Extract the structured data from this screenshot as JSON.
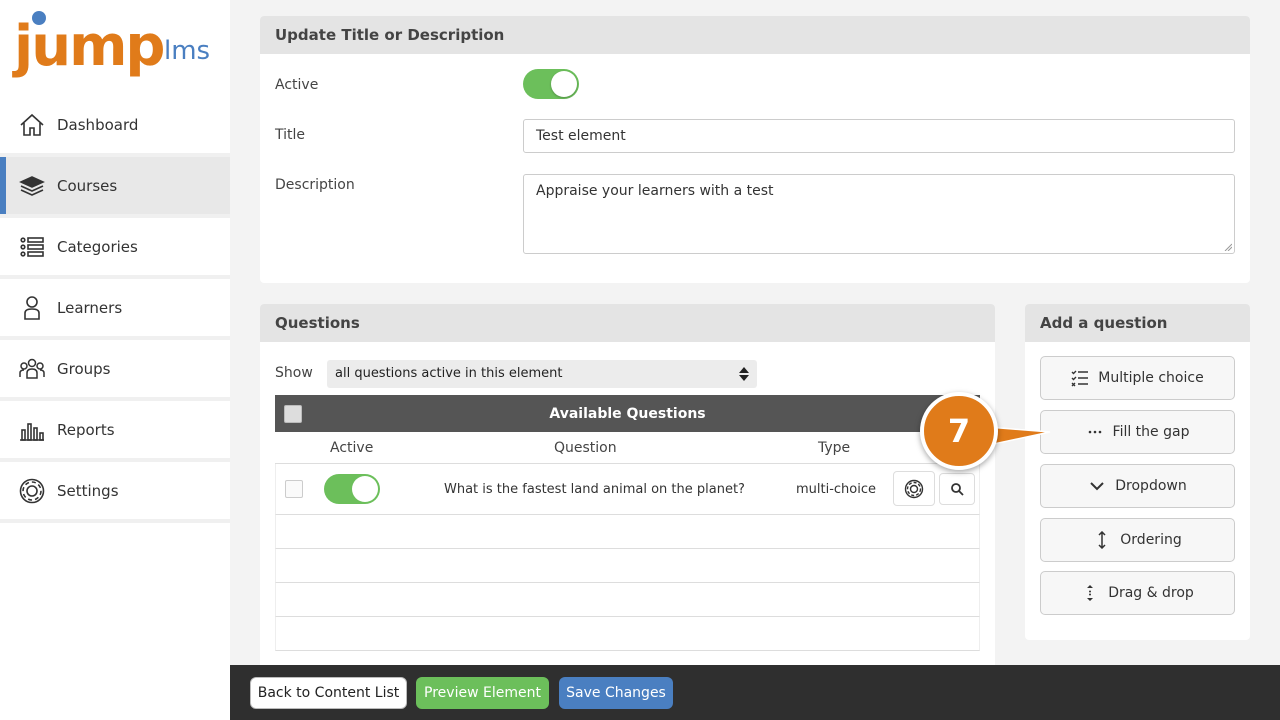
{
  "logo": {
    "jump": "jump",
    "lms": "lms"
  },
  "sidebar": {
    "items": [
      {
        "label": "Dashboard",
        "icon": "home-icon"
      },
      {
        "label": "Courses",
        "icon": "books-icon",
        "active": true
      },
      {
        "label": "Categories",
        "icon": "list-icon"
      },
      {
        "label": "Learners",
        "icon": "person-icon"
      },
      {
        "label": "Groups",
        "icon": "group-icon"
      },
      {
        "label": "Reports",
        "icon": "bar-chart-icon"
      },
      {
        "label": "Settings",
        "icon": "gear-icon"
      }
    ]
  },
  "update_panel": {
    "header": "Update Title or Description",
    "active_label": "Active",
    "title_label": "Title",
    "title_value": "Test element",
    "description_label": "Description",
    "description_value": "Appraise your learners with a test"
  },
  "questions_panel": {
    "header": "Questions",
    "show_label": "Show",
    "show_value": "all questions active in this element",
    "table_title": "Available Questions",
    "columns": {
      "active": "Active",
      "question": "Question",
      "type": "Type"
    },
    "rows": [
      {
        "question": "What is the fastest land animal on the planet?",
        "type": "multi-choice"
      }
    ]
  },
  "add_panel": {
    "header": "Add a question",
    "buttons": [
      {
        "label": "Multiple choice",
        "icon": "checklist-icon"
      },
      {
        "label": "Fill the gap",
        "icon": "ellipsis-icon"
      },
      {
        "label": "Dropdown",
        "icon": "chevron-down-icon"
      },
      {
        "label": "Ordering",
        "icon": "vertical-arrows-icon"
      },
      {
        "label": "Drag & drop",
        "icon": "drag-icon"
      }
    ]
  },
  "footer": {
    "back": "Back to Content List",
    "preview": "Preview Element",
    "save": "Save Changes"
  },
  "callout": {
    "number": "7"
  },
  "colors": {
    "accent_orange": "#e07b1a",
    "blue": "#4a7fc1",
    "green": "#6cbf5b"
  }
}
